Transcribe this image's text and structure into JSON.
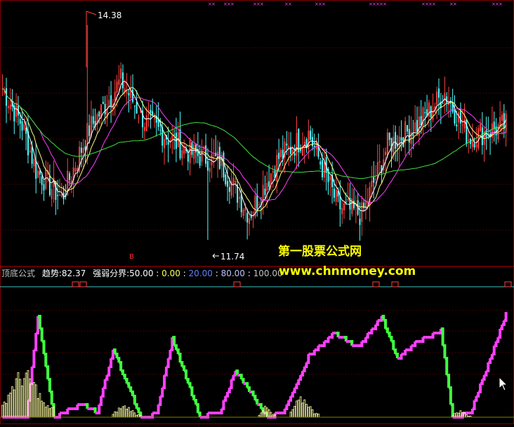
{
  "colors": {
    "background": "#000000",
    "grid": "#7a0000",
    "candle_up": "#ff4040",
    "candle_down": "#54ffff",
    "ma_white": "#ffffff",
    "ma_yellow": "#ffff80",
    "ma_magenta": "#ff40ff",
    "ma_green": "#40e040",
    "osc_rise": "#ff40ff",
    "osc_fall": "#40ff40",
    "vol_bar": "#ffffa0",
    "threshold_line": "#40c0c0",
    "signal_box": "#ff4040",
    "watermark": "#ffff00",
    "top_marks": "#ff40ff"
  },
  "price_panel": {
    "high_label": "14.38",
    "low_label": "11.74",
    "buy_marker": "B"
  },
  "indicator_panel": {
    "name": "顶底公式",
    "trend_label": "趋势:",
    "trend_value": "82.37",
    "strength_label": "强弱分界:",
    "levels": [
      "50.00",
      "0.00",
      "20.00",
      "80.00",
      "100.00"
    ]
  },
  "watermark": {
    "line1": "第一股票公式网",
    "line2": "www.chnmoney.com"
  },
  "chart_data": [
    {
      "type": "candlestick",
      "title": "",
      "series": [
        {
          "name": "price",
          "keypoints_x": [
            0,
            10,
            17,
            30,
            44,
            60,
            72,
            96,
            110,
            125,
            140,
            155,
            170,
            182,
            195,
            210,
            224,
            236,
            255
          ],
          "keypoints_y": [
            13.6,
            13.15,
            12.6,
            12.25,
            13.1,
            13.7,
            13.2,
            12.8,
            12.7,
            12.05,
            12.75,
            13.05,
            12.15,
            12.05,
            12.9,
            13.15,
            13.55,
            13.0,
            13.15
          ]
        }
      ],
      "annotations": [
        "14.38",
        "11.74"
      ]
    },
    {
      "type": "line",
      "title": "",
      "ylim": [
        0,
        100
      ],
      "thresholds": [
        20,
        50,
        80,
        100
      ],
      "trend_value": 82.37,
      "series": [
        {
          "name": "趋势",
          "keypoints_x": [
            0,
            12,
            18,
            26,
            40,
            48,
            56,
            70,
            78,
            86,
            100,
            110,
            118,
            134,
            142,
            155,
            168,
            180,
            192,
            200,
            210,
            222,
            228,
            237,
            255
          ],
          "keypoints_y": [
            0,
            1,
            95,
            0,
            12,
            4,
            64,
            0,
            3,
            74,
            0,
            5,
            44,
            0,
            4,
            58,
            80,
            66,
            95,
            56,
            72,
            82,
            0,
            4,
            98
          ]
        }
      ]
    }
  ]
}
